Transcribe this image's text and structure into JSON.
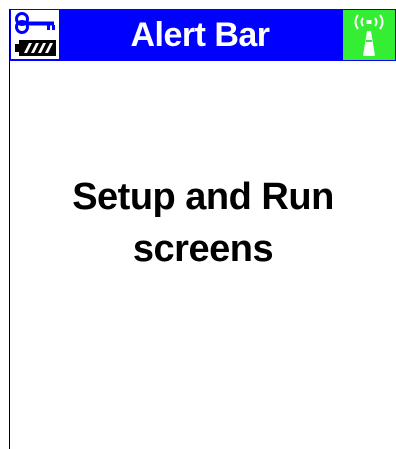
{
  "alert_bar": {
    "title": "Alert Bar",
    "background_color": "#0000ff",
    "title_color": "#ffffff",
    "left_icons": [
      "key-icon",
      "battery-icon"
    ],
    "right_icon": "wireless-signal-icon",
    "signal_color": "#33ee33"
  },
  "main": {
    "line1": "Setup and Run",
    "line2": "screens"
  }
}
